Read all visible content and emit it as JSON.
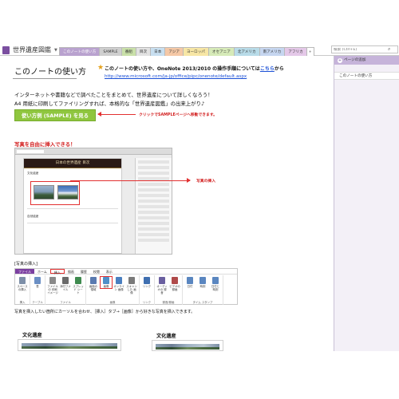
{
  "notebook": {
    "name": "世界遺産図鑑"
  },
  "tabs": [
    {
      "label": "このノートの使い方",
      "color": "#b9a2cf",
      "active": true
    },
    {
      "label": "SAMPLE",
      "color": "#cfcfcf"
    },
    {
      "label": "番組",
      "color": "#c9e0a9"
    },
    {
      "label": "目次",
      "color": "#e2e2e2"
    },
    {
      "label": "日本",
      "color": "#c8dff0"
    },
    {
      "label": "アジア",
      "color": "#f5c8a6"
    },
    {
      "label": "ヨーロッパ",
      "color": "#f7e6a5"
    },
    {
      "label": "オセアニア",
      "color": "#d6eab8"
    },
    {
      "label": "北アメリカ",
      "color": "#b8dbe8"
    },
    {
      "label": "南アメリカ",
      "color": "#c6d6f0"
    },
    {
      "label": "アフリカ",
      "color": "#e4c8e8"
    },
    {
      "label": "+",
      "color": "#ffffff"
    }
  ],
  "search": {
    "placeholder": "検索 (Ctrl+E)"
  },
  "page_pane": {
    "add_page": "ページの追加",
    "items": [
      "このノートの使い方"
    ]
  },
  "page": {
    "title": "このノートの使い方",
    "intro_before_link": "このノートの使い方や、OneNote 2013/2010 の操作手順については",
    "intro_link": "こちら",
    "intro_after_link": "から",
    "url": "http://www.microsoft.com/ja-jp/office/pipc/onenote/default.aspx",
    "body_line1": "インターネットや書籍などで調べたことをまとめて、世界遺産について詳しくなろう！",
    "body_line2": "A4 用紙に印刷してファイリングすれば、本格的な「世界遺産図鑑」の出来上がり♪",
    "sample_button": "使い方例 (SAMPLE) を見る",
    "sample_note": "クリックでSAMPLEページへ移動できます。",
    "photo_heading": "写真を自由に挿入できる！",
    "photo_note": "写真の挿入",
    "ribbon_caption": "[写真の挿入]",
    "insert_caption": "写真を挿入したい箇所にカーソルを合わせ、［挿入］タブ→［画像］から好きな写真を挿入できます。",
    "section_left": "文化遺産",
    "section_right": "文化遺産"
  },
  "screenshot": {
    "header": "日本の世界遺産 目次",
    "label_top": "文化遺産",
    "label_bottom": "自然遺産"
  },
  "ribbon": {
    "tabs": [
      "ファイル",
      "ホーム",
      "挿入",
      "描画",
      "履歴",
      "校閲",
      "表示"
    ],
    "groups": [
      {
        "label": "挿入",
        "buttons": [
          {
            "label": "スペース の挿入",
            "color": "#7d8fa8"
          }
        ]
      },
      {
        "label": "テーブル",
        "buttons": [
          {
            "label": "表",
            "color": "#6b8fc4"
          }
        ]
      },
      {
        "label": "ファイル",
        "buttons": [
          {
            "label": "ファイルの 印刷イメージ",
            "color": "#8a8a8a"
          },
          {
            "label": "添付ファイル",
            "color": "#6a6a6a"
          },
          {
            "label": "スプレッド シート",
            "color": "#3f8a4f"
          }
        ]
      },
      {
        "label": "画像",
        "buttons": [
          {
            "label": "画面の 領域",
            "color": "#5a7ab0"
          },
          {
            "label": "画像",
            "color": "#4f8fc8",
            "highlight": true
          },
          {
            "label": "オンライン 画像",
            "color": "#4a7fc0"
          },
          {
            "label": "スキャンした 画像",
            "color": "#7a7a7a"
          }
        ]
      },
      {
        "label": "リンク",
        "buttons": [
          {
            "label": "リンク",
            "color": "#3f6fb0"
          }
        ]
      },
      {
        "label": "録音/録画",
        "buttons": [
          {
            "label": "オーディオの 録音",
            "color": "#6a5fa0"
          },
          {
            "label": "ビデオの 録画",
            "color": "#b04a4a"
          }
        ]
      },
      {
        "label": "タイム スタンプ",
        "buttons": [
          {
            "label": "日付",
            "color": "#5a86c0"
          },
          {
            "label": "時刻",
            "color": "#5a86c0"
          },
          {
            "label": "日付と 時刻",
            "color": "#5a86c0"
          }
        ]
      }
    ]
  },
  "colors": {
    "accent": "#7b3fa0",
    "green_button": "#8fc63f",
    "red": "#e23030",
    "link": "#1a4fd6"
  }
}
